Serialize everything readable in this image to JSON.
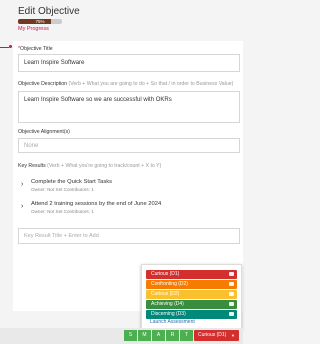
{
  "header": {
    "title": "Edit Objective",
    "progress_value": 0.75,
    "progress_text": "75%",
    "progress_label": "My Progress"
  },
  "form": {
    "objective_title_label": "Objective Title",
    "objective_title_value": "Learn Inspire Software",
    "description_label": "Objective Description",
    "description_hint": "(Verb + What you are going to do + So that / in order to Business Value)",
    "description_value": "Learn Inspire Software so we are successful with OKRs",
    "alignment_label": "Objective Alignment(s)",
    "alignment_value": "None",
    "key_results_label": "Key Results",
    "key_results_hint": "(Verb + What you're going to track/count + X to Y)",
    "key_results": [
      {
        "title": "Complete the Quick Start Tasks",
        "meta": "Owner: Not Set    Contributors: 1"
      },
      {
        "title": "Attend 2 training sessions by the end of June 2024",
        "meta": "Owner: Not Set    Contributors: 1"
      }
    ],
    "kr_placeholder": "Key Result Title + Enter to Add"
  },
  "menu": {
    "items": [
      {
        "label": "Curious (D1)",
        "color": "#d32f2f"
      },
      {
        "label": "Confronting (D2)",
        "color": "#f57c00"
      },
      {
        "label": "Curious (D2)",
        "color": "#fbc02d"
      },
      {
        "label": "Achieving (D4)",
        "color": "#388e3c"
      },
      {
        "label": "Discerning (D3)",
        "color": "#00897b"
      }
    ],
    "launch": "Launch Assessment"
  },
  "footer": {
    "smart": [
      "S",
      "M",
      "A",
      "R",
      "T"
    ],
    "smart_color": "#4caf50",
    "curious_button": "Curious (D1)"
  }
}
